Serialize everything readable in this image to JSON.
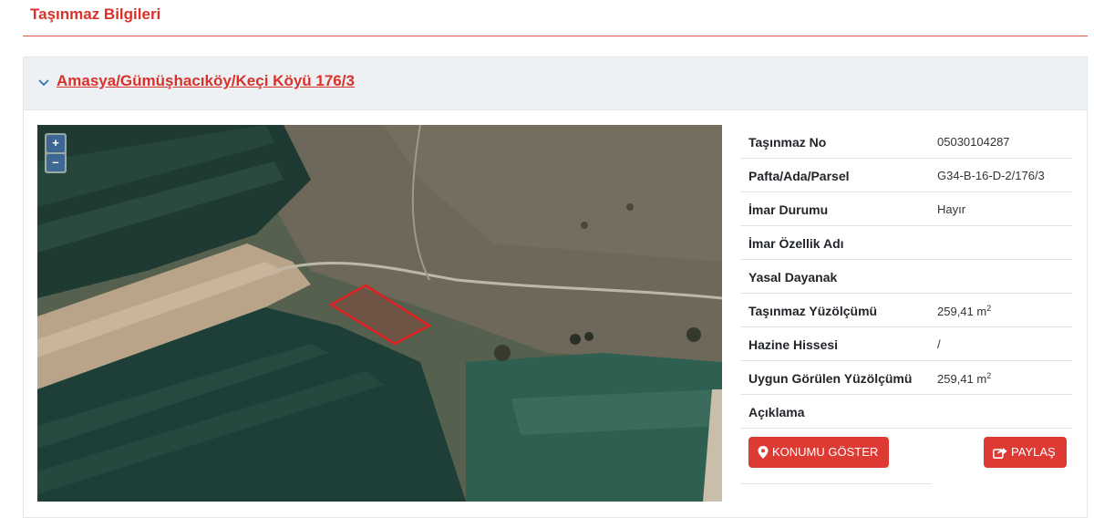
{
  "header": {
    "title": "Taşınmaz Bilgileri"
  },
  "panel": {
    "property_title": "Amasya/Gümüşhacıköy/Keçi Köyü 176/3"
  },
  "map": {
    "zoom_in": "+",
    "zoom_out": "–"
  },
  "info": {
    "rows": [
      {
        "label": "Taşınmaz No",
        "value": "05030104287"
      },
      {
        "label": "Pafta/Ada/Parsel",
        "value": "G34-B-16-D-2/176/3"
      },
      {
        "label": "İmar Durumu",
        "value": "Hayır"
      },
      {
        "label": "İmar Özellik Adı",
        "value": ""
      },
      {
        "label": "Yasal Dayanak",
        "value": ""
      },
      {
        "label": "Taşınmaz Yüzölçümü",
        "value": "259,41 m",
        "unit_sup": "2"
      },
      {
        "label": "Hazine Hissesi",
        "value": "/"
      },
      {
        "label": "Uygun Görülen Yüzölçümü",
        "value": "259,41 m",
        "unit_sup": "2"
      },
      {
        "label": "Açıklama",
        "value": ""
      }
    ]
  },
  "actions": {
    "show_location": "KONUMU GÖSTER",
    "share": "PAYLAŞ"
  },
  "colors": {
    "accent": "#dc3a33",
    "panel_header": "#eef1f4",
    "parcel_outline": "#e02020"
  }
}
